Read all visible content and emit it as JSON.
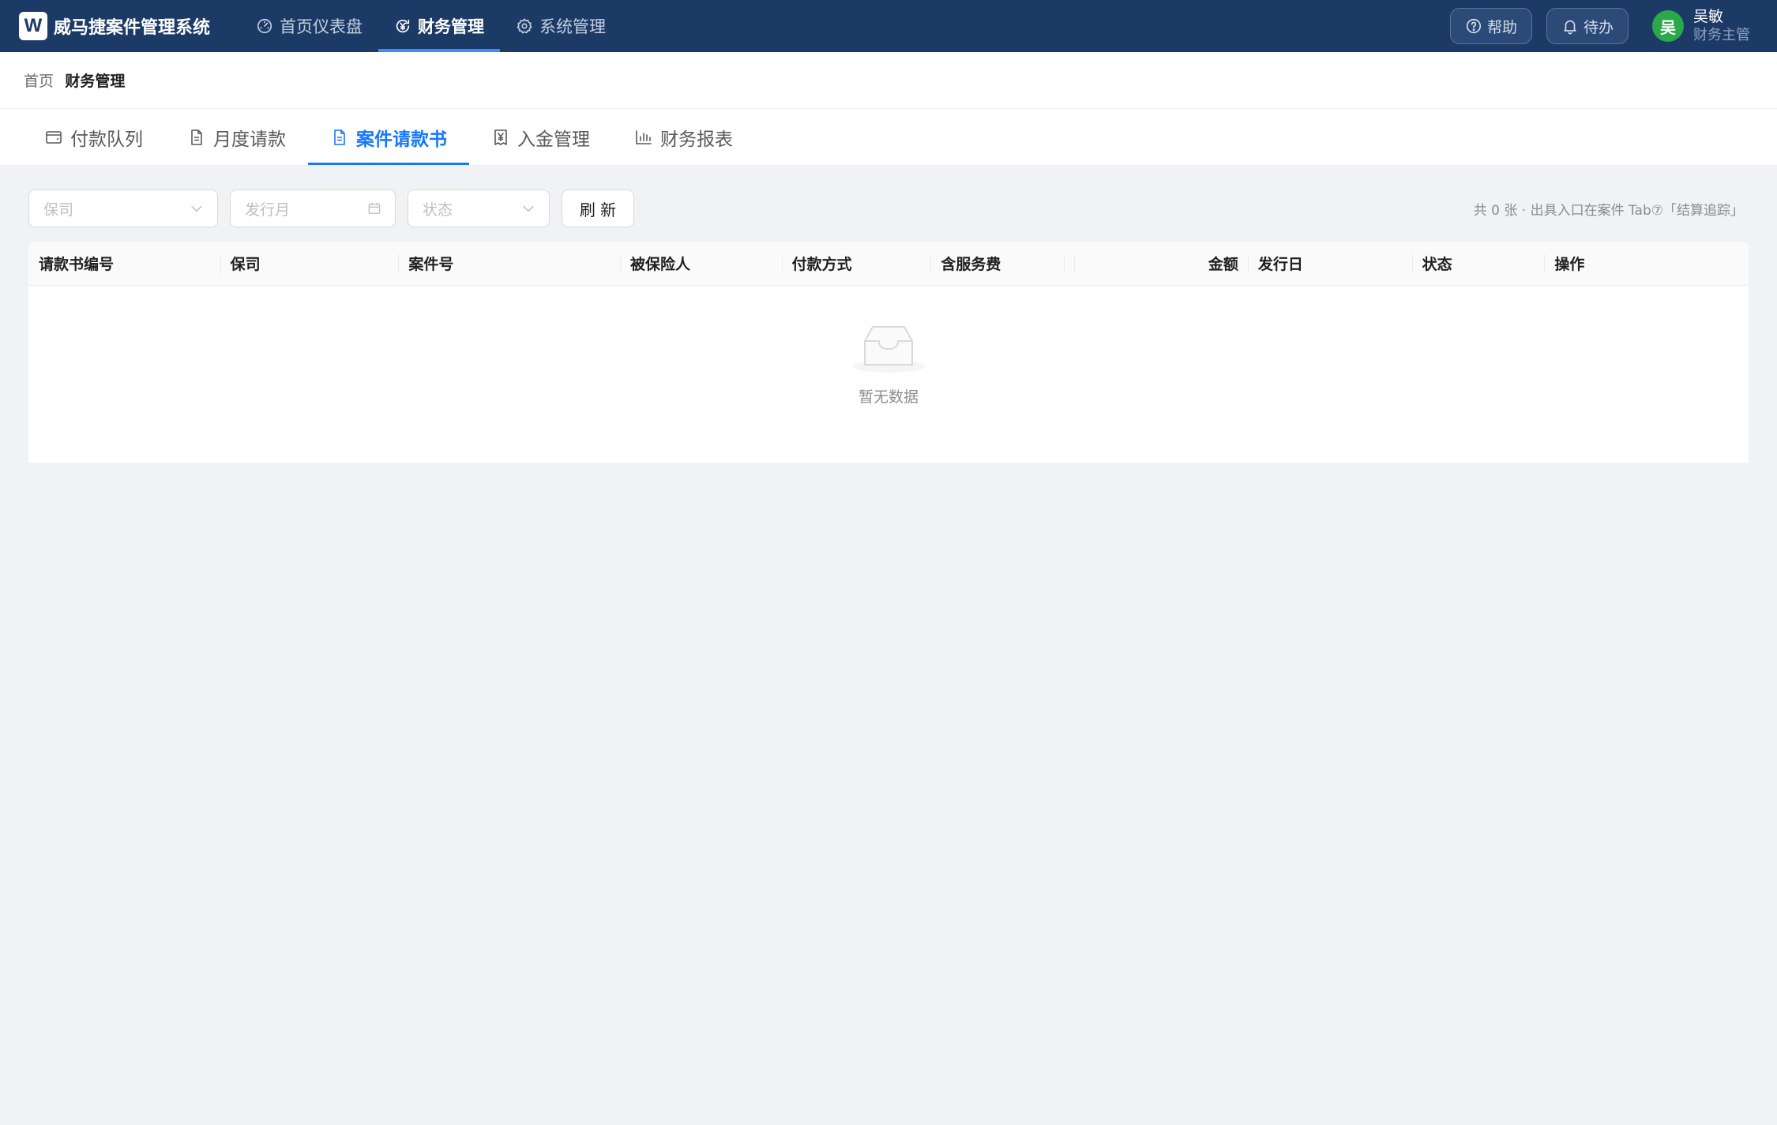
{
  "app": {
    "logo_letter": "W",
    "name": "威马捷案件管理系统"
  },
  "topnav": {
    "items": [
      {
        "label": "首页仪表盘",
        "icon": "dashboard-icon"
      },
      {
        "label": "财务管理",
        "icon": "finance-icon",
        "active": true
      },
      {
        "label": "系统管理",
        "icon": "gear-icon"
      }
    ]
  },
  "actions": {
    "help_label": "帮助",
    "todo_label": "待办"
  },
  "user": {
    "avatar_initial": "吴",
    "name": "吴敏",
    "role": "财务主管"
  },
  "breadcrumb": {
    "home": "首页",
    "separator": "/",
    "current": "财务管理"
  },
  "tabs": [
    {
      "label": "付款队列",
      "icon": "wallet-icon"
    },
    {
      "label": "月度请款",
      "icon": "document-icon"
    },
    {
      "label": "案件请款书",
      "icon": "document-icon",
      "active": true
    },
    {
      "label": "入金管理",
      "icon": "yen-receipt-icon"
    },
    {
      "label": "财务报表",
      "icon": "bar-chart-icon"
    }
  ],
  "filters": {
    "insurer_placeholder": "保司",
    "month_placeholder": "发行月",
    "status_placeholder": "状态",
    "refresh_label": "刷 新",
    "hint": "共 0 张 · 出具入口在案件 Tab⑦「结算追踪」"
  },
  "table": {
    "columns": [
      "请款书编号",
      "保司",
      "案件号",
      "被保险人",
      "付款方式",
      "含服务费",
      "",
      "金额",
      "发行日",
      "状态",
      "操作"
    ],
    "rows": [],
    "empty_text": "暂无数据"
  },
  "colors": {
    "topbar": "#1c3a66",
    "accent": "#1677ff",
    "avatar": "#2ba84a",
    "background": "#f0f2f5"
  }
}
